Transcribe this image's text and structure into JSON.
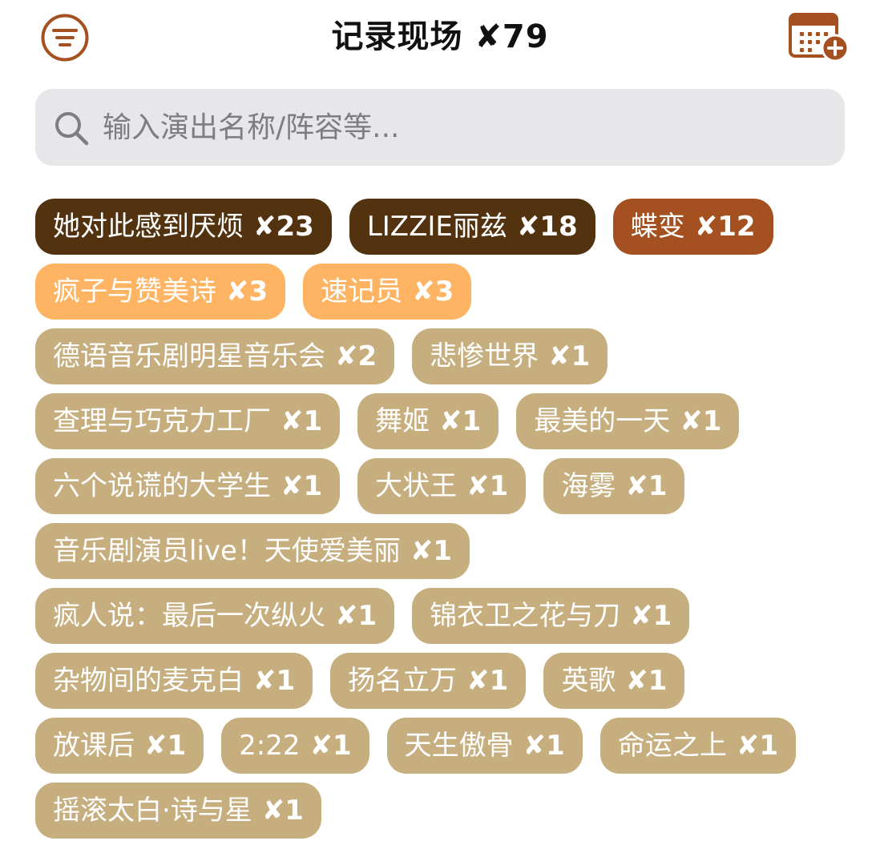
{
  "header": {
    "title": "记录现场 ✘79"
  },
  "search": {
    "placeholder": "输入演出名称/阵容等..."
  },
  "colors": {
    "accent": "#a55020",
    "tag_level_1": "#52320f",
    "tag_level_2": "#a55020",
    "tag_level_3": "#ffb463",
    "tag_level_4": "#c7ae7f"
  },
  "tags": [
    {
      "name": "她对此感到厌烦",
      "count": "✘23",
      "level": 1
    },
    {
      "name": "LIZZIE丽兹",
      "count": "✘18",
      "level": 1
    },
    {
      "name": "蝶变",
      "count": "✘12",
      "level": 2
    },
    {
      "name": "疯子与赞美诗",
      "count": "✘3",
      "level": 3
    },
    {
      "name": "速记员",
      "count": "✘3",
      "level": 3
    },
    {
      "name": "德语音乐剧明星音乐会",
      "count": "✘2",
      "level": 4
    },
    {
      "name": "悲惨世界",
      "count": "✘1",
      "level": 4
    },
    {
      "name": "查理与巧克力工厂",
      "count": "✘1",
      "level": 4
    },
    {
      "name": "舞姬",
      "count": "✘1",
      "level": 4
    },
    {
      "name": "最美的一天",
      "count": "✘1",
      "level": 4
    },
    {
      "name": "六个说谎的大学生",
      "count": "✘1",
      "level": 4
    },
    {
      "name": "大状王",
      "count": "✘1",
      "level": 4
    },
    {
      "name": "海雾",
      "count": "✘1",
      "level": 4
    },
    {
      "name": "音乐剧演员live！天使爱美丽",
      "count": "✘1",
      "level": 4
    },
    {
      "name": "疯人说：最后一次纵火",
      "count": "✘1",
      "level": 4
    },
    {
      "name": "锦衣卫之花与刀",
      "count": "✘1",
      "level": 4
    },
    {
      "name": "杂物间的麦克白",
      "count": "✘1",
      "level": 4
    },
    {
      "name": "扬名立万",
      "count": "✘1",
      "level": 4
    },
    {
      "name": "英歌",
      "count": "✘1",
      "level": 4
    },
    {
      "name": "放课后",
      "count": "✘1",
      "level": 4
    },
    {
      "name": "2:22",
      "count": "✘1",
      "level": 4
    },
    {
      "name": "天生傲骨",
      "count": "✘1",
      "level": 4
    },
    {
      "name": "命运之上",
      "count": "✘1",
      "level": 4
    },
    {
      "name": "摇滚太白·诗与星",
      "count": "✘1",
      "level": 4
    }
  ]
}
